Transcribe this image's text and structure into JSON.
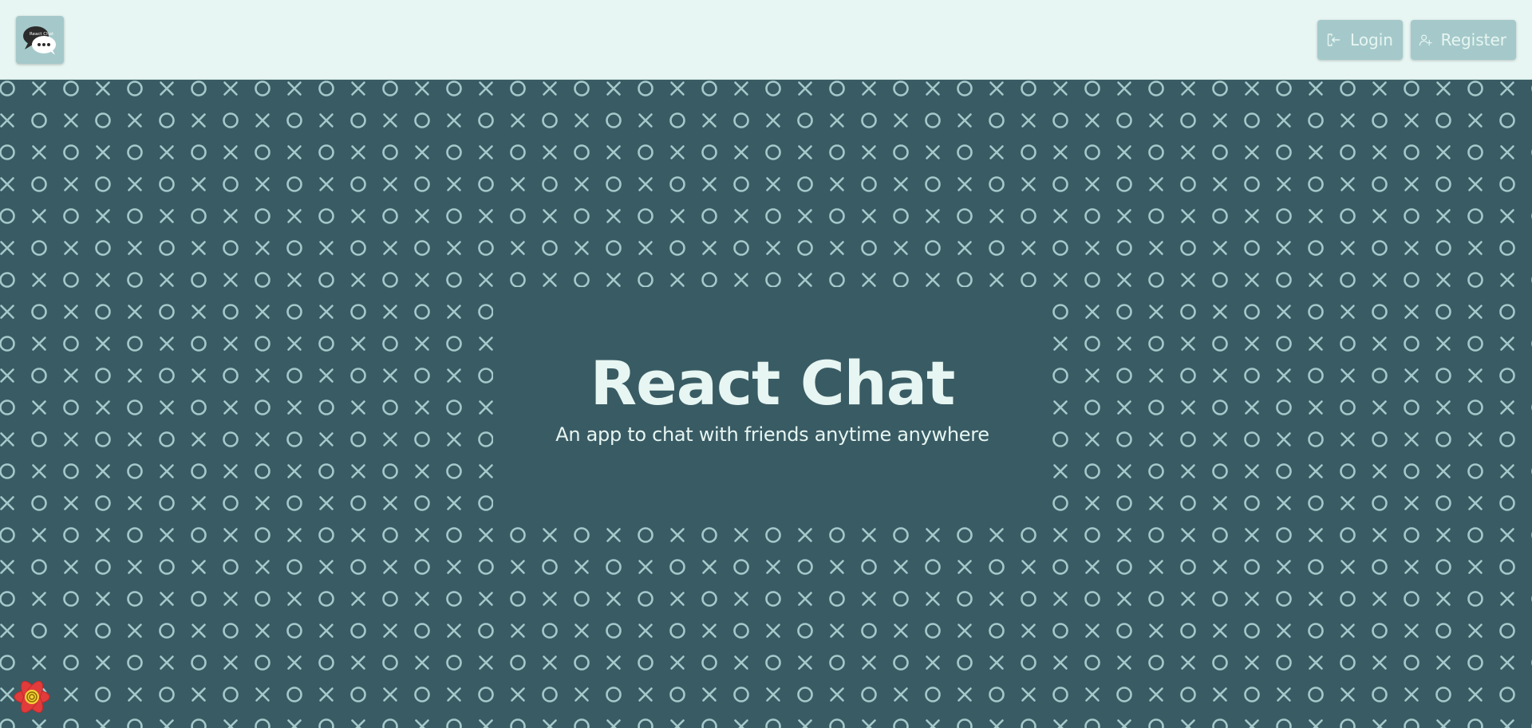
{
  "header": {
    "logo": {
      "icon": "chat-bubbles-logo-icon",
      "logo_text": "React Chat"
    },
    "login_label": "Login",
    "login_icon": "login-icon",
    "register_label": "Register",
    "register_icon": "add-user-icon"
  },
  "hero": {
    "title": "React Chat",
    "subtitle": "An app to chat with friends anytime anywhere"
  },
  "background": {
    "pattern": "tic-tac-toe X and O grid",
    "color": "#395b64",
    "symbol_color": "#a5c9ca"
  },
  "colors": {
    "header_bg": "#e7f6f2",
    "button_bg": "#a5c9ca",
    "button_text": "#e7f6f2",
    "page_bg": "#395b64"
  },
  "dev_badge": {
    "icon": "react-devtools-icon"
  }
}
